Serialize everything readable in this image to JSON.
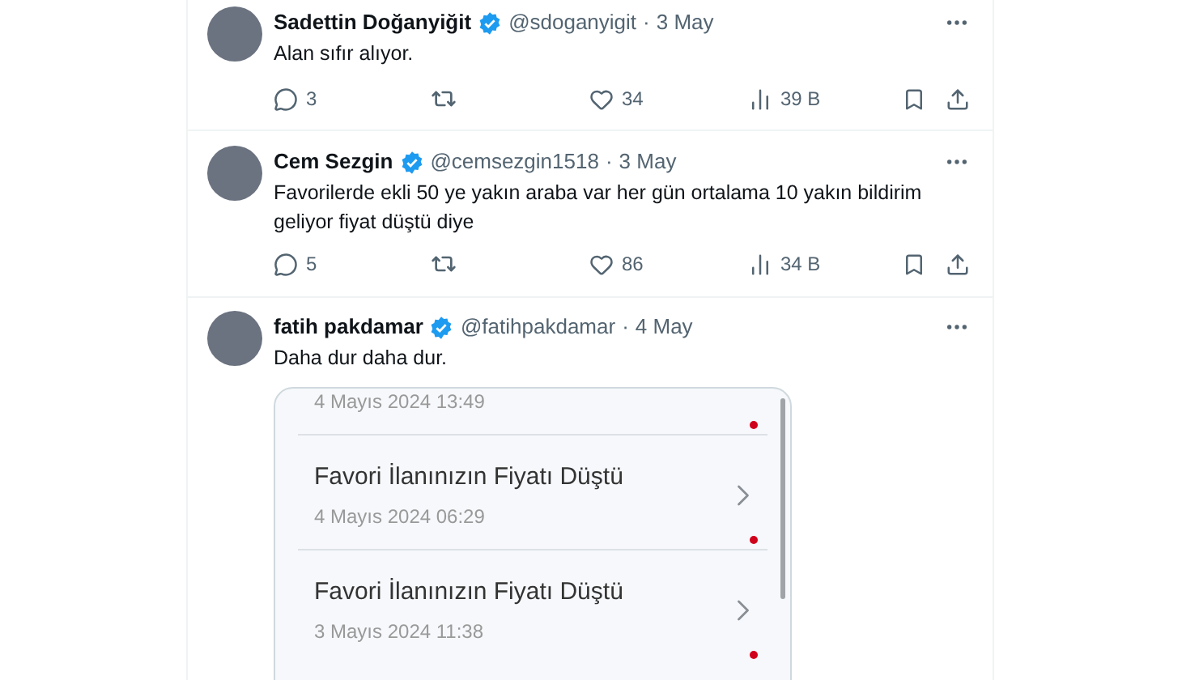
{
  "tweets": [
    {
      "name": "Sadettin Doğanyiğit",
      "verified": true,
      "handle": "@sdoganyigit",
      "separator": "·",
      "date": "3 May",
      "text": "Alan sıfır alıyor.",
      "replies": "3",
      "likes": "34",
      "views": "39 B"
    },
    {
      "name": "Cem Sezgin",
      "verified": true,
      "handle": "@cemsezgin1518",
      "separator": "·",
      "date": "3 May",
      "text": "Favorilerde ekli 50 ye yakın araba var her gün ortalama 10 yakın bildirim geliyor fiyat düştü diye",
      "replies": "5",
      "likes": "86",
      "views": "34 B"
    },
    {
      "name": "fatih pakdamar",
      "verified": true,
      "handle": "@fatihpakdamar",
      "separator": "·",
      "date": "4 May",
      "text": "Daha dur daha dur.",
      "image": {
        "notifications": [
          {
            "date": "4 Mayıs 2024 13:49",
            "unread": true
          },
          {
            "title": "Favori İlanınızın Fiyatı Düştü",
            "date": "4 Mayıs 2024 06:29",
            "unread": true
          },
          {
            "title": "Favori İlanınızın Fiyatı Düştü",
            "date": "3 Mayıs 2024 11:38",
            "unread": true
          }
        ]
      }
    }
  ]
}
